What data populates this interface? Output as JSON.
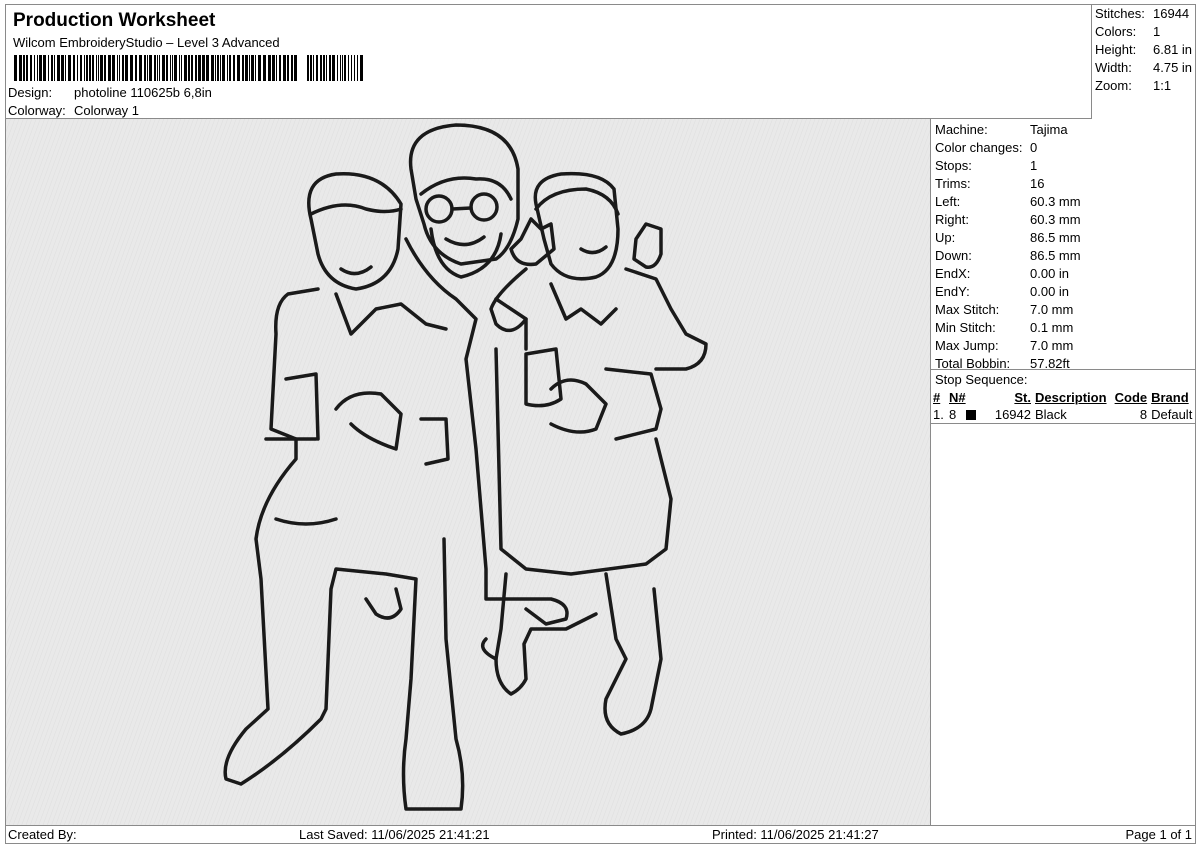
{
  "header": {
    "title": "Production Worksheet",
    "subtitle": "Wilcom EmbroideryStudio – Level 3 Advanced",
    "design_label": "Design:",
    "design_value": "photoline 110625b 6,8in",
    "colorway_label": "Colorway:",
    "colorway_value": "Colorway 1"
  },
  "stats": [
    {
      "label": "Stitches:",
      "value": "16944"
    },
    {
      "label": "Colors:",
      "value": "1"
    },
    {
      "label": "Height:",
      "value": "6.81 in"
    },
    {
      "label": "Width:",
      "value": "4.75 in"
    },
    {
      "label": "Zoom:",
      "value": "1:1"
    }
  ],
  "machine_info": [
    {
      "label": "Machine:",
      "value": "Tajima"
    },
    {
      "label": "Color changes:",
      "value": "0"
    },
    {
      "label": "Stops:",
      "value": "1"
    },
    {
      "label": "Trims:",
      "value": "16"
    },
    {
      "label": "Left:",
      "value": "60.3 mm"
    },
    {
      "label": "Right:",
      "value": "60.3 mm"
    },
    {
      "label": "Up:",
      "value": "86.5 mm"
    },
    {
      "label": "Down:",
      "value": "86.5 mm"
    },
    {
      "label": "EndX:",
      "value": "0.00 in"
    },
    {
      "label": "EndY:",
      "value": "0.00 in"
    },
    {
      "label": "Max Stitch:",
      "value": "7.0 mm"
    },
    {
      "label": "Min Stitch:",
      "value": "0.1 mm"
    },
    {
      "label": "Max Jump:",
      "value": "7.0 mm"
    },
    {
      "label": "Total Bobbin:",
      "value": "57.82ft"
    }
  ],
  "stop_sequence": {
    "title": "Stop Sequence:",
    "headers": {
      "num": "#",
      "n": "N#",
      "st": "St.",
      "description": "Description",
      "code": "Code",
      "brand": "Brand"
    },
    "rows": [
      {
        "num": "1.",
        "n": "8",
        "swatch_color": "#000000",
        "st": "16942",
        "description": "Black",
        "code": "8",
        "brand": "Default"
      }
    ]
  },
  "footer": {
    "created_by": "Created By:",
    "last_saved": "Last Saved: 11/06/2025 21:41:21",
    "printed": "Printed: 11/06/2025 21:41:27",
    "page": "Page 1 of 1"
  },
  "colors": {
    "stitch": "#1a1a1a",
    "canvas": "#e9e9e9",
    "border": "#8a8a8a"
  }
}
